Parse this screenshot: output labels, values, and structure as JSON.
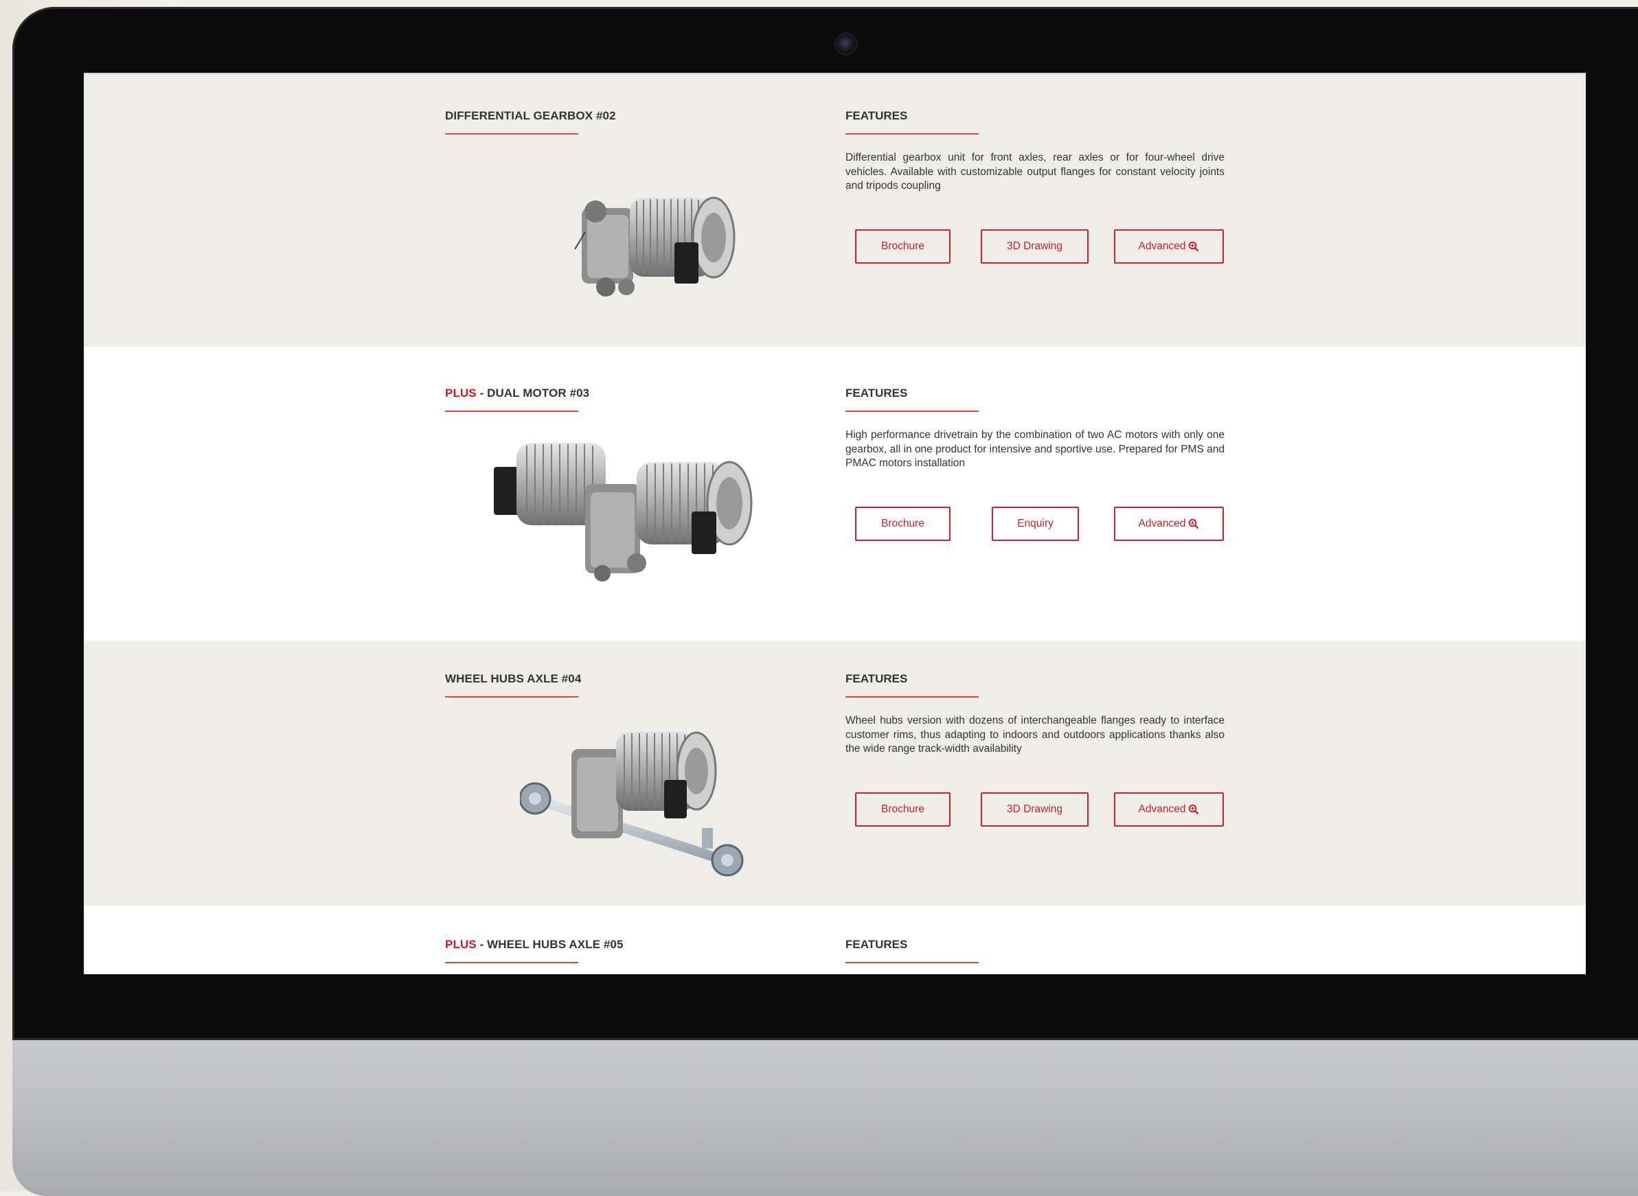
{
  "products": [
    {
      "prefix": "",
      "name": "DIFFERENTIAL GEARBOX #02",
      "features_label": "FEATURES",
      "description": "Differential gearbox unit for front axles, rear axles or for four-wheel drive vehicles. Available with customizable output flanges for constant velocity joints and tripods coupling",
      "buttons": [
        "Brochure",
        "3D Drawing",
        "Advanced"
      ]
    },
    {
      "prefix": "PLUS",
      "name": " - DUAL MOTOR #03",
      "features_label": "FEATURES",
      "description": "High performance drivetrain by the combination of two AC motors with only one gearbox, all in one product for intensive and sportive use. Prepared for PMS and PMAC motors installation",
      "buttons": [
        "Brochure",
        "Enquiry",
        "Advanced"
      ]
    },
    {
      "prefix": "",
      "name": "WHEEL HUBS AXLE #04",
      "features_label": "FEATURES",
      "description": "Wheel hubs version with dozens of interchangeable flanges ready to interface customer rims, thus adapting to indoors and outdoors applications thanks also the wide range track-width availability",
      "buttons": [
        "Brochure",
        "3D Drawing",
        "Advanced"
      ]
    },
    {
      "prefix": "PLUS",
      "name": " - WHEEL HUBS AXLE #05",
      "features_label": "FEATURES"
    }
  ],
  "icons": {
    "advanced": "zoom-in-icon",
    "camera": "webcam-icon"
  },
  "colors": {
    "accent": "#d4181e",
    "section_alt": "#eeede8"
  }
}
